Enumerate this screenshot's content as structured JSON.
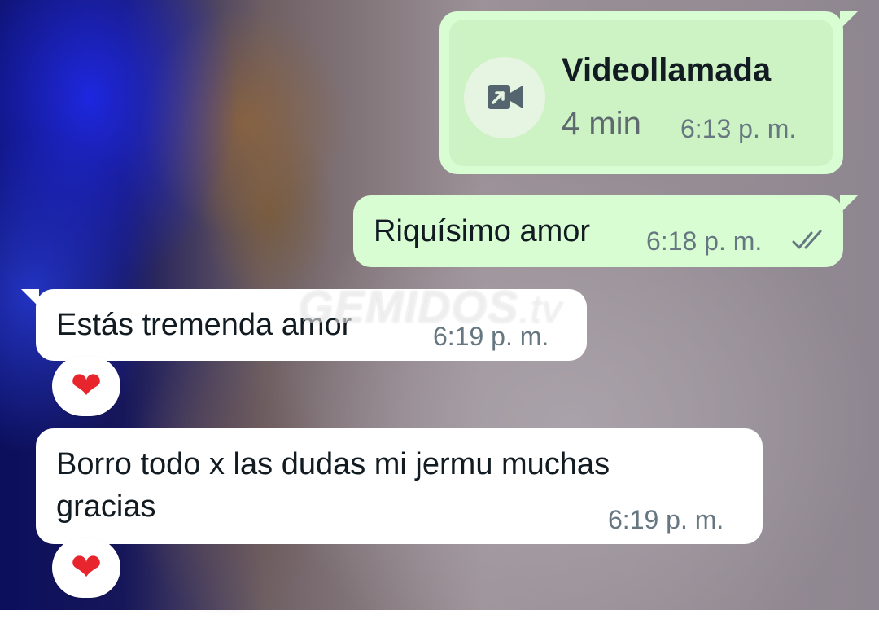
{
  "messages": [
    {
      "type": "video_call",
      "direction": "outgoing",
      "icon": "video-call-outgoing-icon",
      "title": "Videollamada",
      "duration": "4 min",
      "time": "6:13 p. m."
    },
    {
      "type": "text",
      "direction": "outgoing",
      "text": "Riquísimo amor",
      "time": "6:18 p. m.",
      "status": "read-double-check-icon"
    },
    {
      "type": "text",
      "direction": "incoming",
      "text": "Estás tremenda amor",
      "time": "6:19 p. m.",
      "reaction": "❤"
    },
    {
      "type": "text",
      "direction": "incoming",
      "text_lines": [
        "Borro todo x las dudas mi jermu muchas",
        "gracias"
      ],
      "time": "6:19 p. m.",
      "reaction": "❤"
    }
  ],
  "watermark": {
    "brand": "GEMIDOS",
    "suffix": ".tv"
  },
  "colors": {
    "outgoing_bubble": "#d9fdd3",
    "incoming_bubble": "#ffffff",
    "timestamp": "#667781",
    "heart": "#e8242c"
  }
}
